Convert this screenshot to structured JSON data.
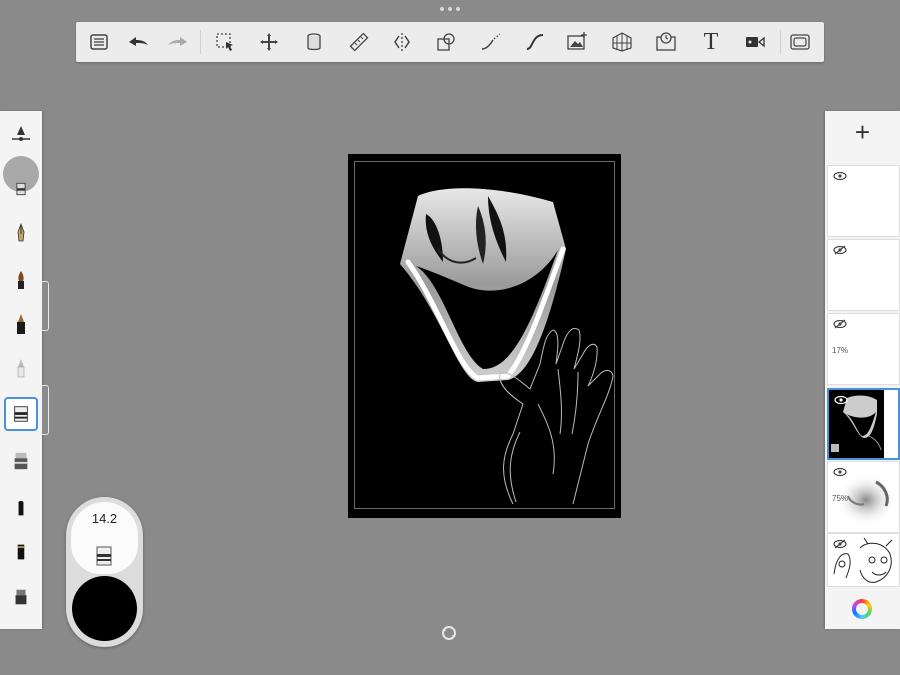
{
  "app": {
    "menu_dots": "•••"
  },
  "toolbar": {
    "items": [
      {
        "name": "list-icon",
        "label": "Menu"
      },
      {
        "name": "undo-icon",
        "label": "Undo"
      },
      {
        "name": "redo-icon",
        "label": "Redo"
      },
      {
        "name": "selection-icon",
        "label": "Selection"
      },
      {
        "name": "transform-icon",
        "label": "Transform"
      },
      {
        "name": "fill-icon",
        "label": "Fill"
      },
      {
        "name": "ruler-icon",
        "label": "Ruler"
      },
      {
        "name": "symmetry-icon",
        "label": "Symmetry"
      },
      {
        "name": "shape-icon",
        "label": "Shapes"
      },
      {
        "name": "steady-stroke-icon",
        "label": "Steady Stroke"
      },
      {
        "name": "curve-icon",
        "label": "Curves"
      },
      {
        "name": "import-image-icon",
        "label": "Import Image"
      },
      {
        "name": "perspective-icon",
        "label": "Perspective"
      },
      {
        "name": "time-lapse-icon",
        "label": "Time-lapse"
      },
      {
        "name": "text-icon",
        "label": "Text",
        "glyph": "T"
      },
      {
        "name": "record-icon",
        "label": "Record"
      },
      {
        "name": "fullscreen-icon",
        "label": "Fullscreen"
      }
    ]
  },
  "brush_palette": {
    "brushes": [
      "brush-size-slider",
      "eraser",
      "fountain-pen",
      "paint-brush",
      "ink-brush",
      "pencil",
      "eraser-selected",
      "marker",
      "felt-tip",
      "brush-pen",
      "airbrush"
    ],
    "selected": "eraser"
  },
  "puck": {
    "size": "14.2",
    "color": "#000000"
  },
  "layers": {
    "add_label": "+",
    "items": [
      {
        "visible": true,
        "opacity": "",
        "thumb": "blank"
      },
      {
        "visible": false,
        "opacity": "",
        "thumb": "blank"
      },
      {
        "visible": false,
        "opacity": "17%",
        "thumb": "blank"
      },
      {
        "visible": true,
        "opacity": "",
        "thumb": "face",
        "selected": true
      },
      {
        "visible": true,
        "opacity": "75%",
        "thumb": "sketch-gray"
      },
      {
        "visible": false,
        "opacity": "",
        "thumb": "line-sketch"
      }
    ]
  },
  "colors": {
    "accent": "#4a90e2",
    "background": "#8a8a8a",
    "toolbar": "#ececec"
  }
}
